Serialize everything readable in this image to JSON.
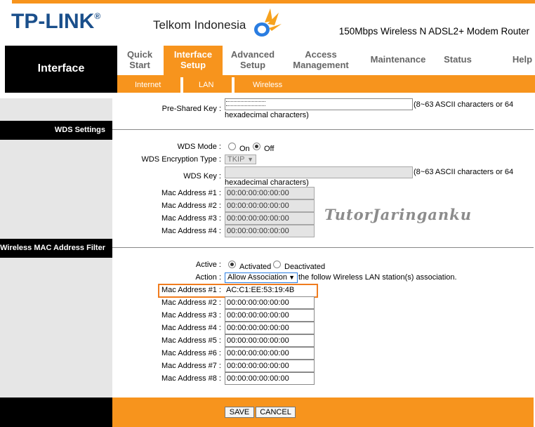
{
  "header": {
    "brand_logo": "TP-LINK",
    "registered": "®",
    "isp_logo": "Telkom Indonesia",
    "product": "150Mbps Wireless N ADSL2+ Modem Router",
    "accent": "#f7941d"
  },
  "nav": {
    "section_title": "Interface",
    "tabs": [
      {
        "l1": "Quick",
        "l2": "Start"
      },
      {
        "l1": "Interface",
        "l2": "Setup"
      },
      {
        "l1": "Advanced",
        "l2": "Setup"
      },
      {
        "l1": "Access",
        "l2": "Management"
      },
      {
        "l1": "Maintenance",
        "l2": ""
      },
      {
        "l1": "Status",
        "l2": ""
      },
      {
        "l1": "Help",
        "l2": ""
      }
    ],
    "subtabs": [
      "Internet",
      "LAN",
      "Wireless"
    ]
  },
  "psk": {
    "label": "Pre-Shared Key :",
    "hint1": "(8~63 ASCII characters or 64",
    "hint2": "hexadecimal characters)"
  },
  "wds": {
    "section": "WDS Settings",
    "mode_label": "WDS Mode :",
    "on": "On",
    "off": "Off",
    "enc_label": "WDS Encryption Type :",
    "enc_value": "TKIP",
    "key_label": "WDS Key :",
    "key_hint1": "(8~63 ASCII characters or 64",
    "key_hint2": "hexadecimal characters)",
    "macs": [
      {
        "label": "Mac Address #1 :",
        "value": "00:00:00:00:00:00"
      },
      {
        "label": "Mac Address #2 :",
        "value": "00:00:00:00:00:00"
      },
      {
        "label": "Mac Address #3 :",
        "value": "00:00:00:00:00:00"
      },
      {
        "label": "Mac Address #4 :",
        "value": "00:00:00:00:00:00"
      }
    ]
  },
  "watermark": "TutorJaringanku",
  "macfilter": {
    "section": "Wireless MAC Address Filter",
    "active_label": "Active :",
    "activated": "Activated",
    "deactivated": "Deactivated",
    "action_label": "Action :",
    "action_value": "Allow Association",
    "action_hint": "the follow Wireless LAN station(s) association.",
    "macs": [
      {
        "label": "Mac Address #1 :",
        "value": "AC:C1:EE:53:19:4B"
      },
      {
        "label": "Mac Address #2 :",
        "value": "00:00:00:00:00:00"
      },
      {
        "label": "Mac Address #3 :",
        "value": "00:00:00:00:00:00"
      },
      {
        "label": "Mac Address #4 :",
        "value": "00:00:00:00:00:00"
      },
      {
        "label": "Mac Address #5 :",
        "value": "00:00:00:00:00:00"
      },
      {
        "label": "Mac Address #6 :",
        "value": "00:00:00:00:00:00"
      },
      {
        "label": "Mac Address #7 :",
        "value": "00:00:00:00:00:00"
      },
      {
        "label": "Mac Address #8 :",
        "value": "00:00:00:00:00:00"
      }
    ]
  },
  "footer": {
    "save": "SAVE",
    "cancel": "CANCEL"
  }
}
